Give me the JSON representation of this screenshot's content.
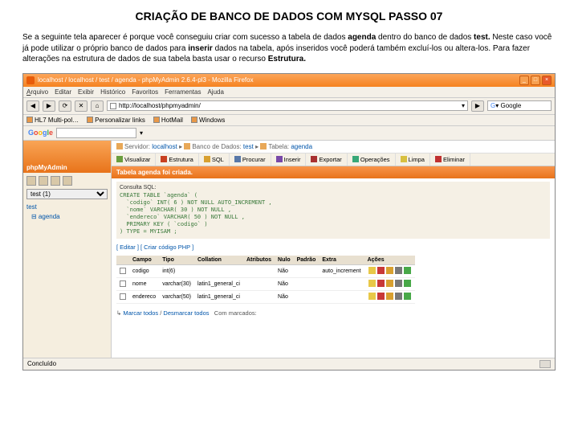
{
  "doc": {
    "title": "CRIAÇÃO DE BANCO DE DADOS COM MYSQL PASSO 07",
    "para_before_agenda": "Se a seguinte tela aparecer é porque você conseguiu criar com sucesso a tabela de dados ",
    "agenda": "agenda",
    "para_mid1": " dentro do banco de dados ",
    "test": "test.",
    "para_mid2": " Neste caso você já pode utilizar o próprio banco de dados para ",
    "inserir": "inserir",
    "para_mid3": " dados na tabela, após inseridos você poderá também excluí-los ou altera-los. Para fazer alterações na estrutura de dados de sua tabela basta usar o recurso ",
    "estrutura": "Estrutura."
  },
  "win": {
    "title": "localhost / localhost / test / agenda - phpMyAdmin 2.6.4-pl3 - Mozilla Firefox"
  },
  "menu": {
    "arquivo": "Arquivo",
    "editar": "Editar",
    "exibir": "Exibir",
    "historico": "Histórico",
    "favoritos": "Favoritos",
    "ferramentas": "Ferramentas",
    "ajuda": "Ajuda"
  },
  "url": {
    "val": "http://localhost/phpmyadmin/",
    "search_ph": "Google",
    "go": "▶"
  },
  "bm": {
    "a": "HL7 Multi-pol…",
    "b": "Personalizar links",
    "c": "HotMail",
    "d": "Windows"
  },
  "sidebar": {
    "logo": "phpMyAdmin",
    "home": "Home",
    "sel": "test (1)",
    "node1": "test",
    "node2": "⊟ agenda"
  },
  "crumb": {
    "server": "Servidor:",
    "srv": "localhost",
    "db": "Banco de Dados:",
    "dbn": "test",
    "tb": "Tabela:",
    "tbn": "agenda",
    "arrow": "▸"
  },
  "tabs": {
    "visualizar": "Visualizar",
    "estrutura": "Estrutura",
    "sql": "SQL",
    "procurar": "Procurar",
    "inserir": "Inserir",
    "exportar": "Exportar",
    "operacoes": "Operações",
    "limpa": "Limpa",
    "eliminar": "Eliminar"
  },
  "banner": "Tabela agenda foi criada.",
  "sql": {
    "lbl": "Consulta SQL:",
    "code": "CREATE TABLE `agenda` (\n  `codigo` INT( 6 ) NOT NULL AUTO_INCREMENT ,\n  `nome` VARCHAR( 30 ) NOT NULL ,\n  `endereco` VARCHAR( 50 ) NOT NULL ,\n  PRIMARY KEY ( `codigo` )\n) TYPE = MYISAM ;"
  },
  "edit": "[ Editar ] [ Criar código PHP ]",
  "th": {
    "campo": "Campo",
    "tipo": "Tipo",
    "collation": "Collation",
    "atributos": "Atributos",
    "nulo": "Nulo",
    "padrao": "Padrão",
    "extra": "Extra",
    "acoes": "Ações"
  },
  "rows": [
    {
      "campo": "codigo",
      "tipo": "int(6)",
      "coll": "",
      "nulo": "Não",
      "extra": "auto_increment"
    },
    {
      "campo": "nome",
      "tipo": "varchar(30)",
      "coll": "latin1_general_ci",
      "nulo": "Não",
      "extra": ""
    },
    {
      "campo": "endereco",
      "tipo": "varchar(50)",
      "coll": "latin1_general_ci",
      "nulo": "Não",
      "extra": ""
    }
  ],
  "mark": {
    "a": "Marcar todos",
    "b": "Desmarcar todos",
    "c": "Com marcados:"
  },
  "status": "Concluído"
}
